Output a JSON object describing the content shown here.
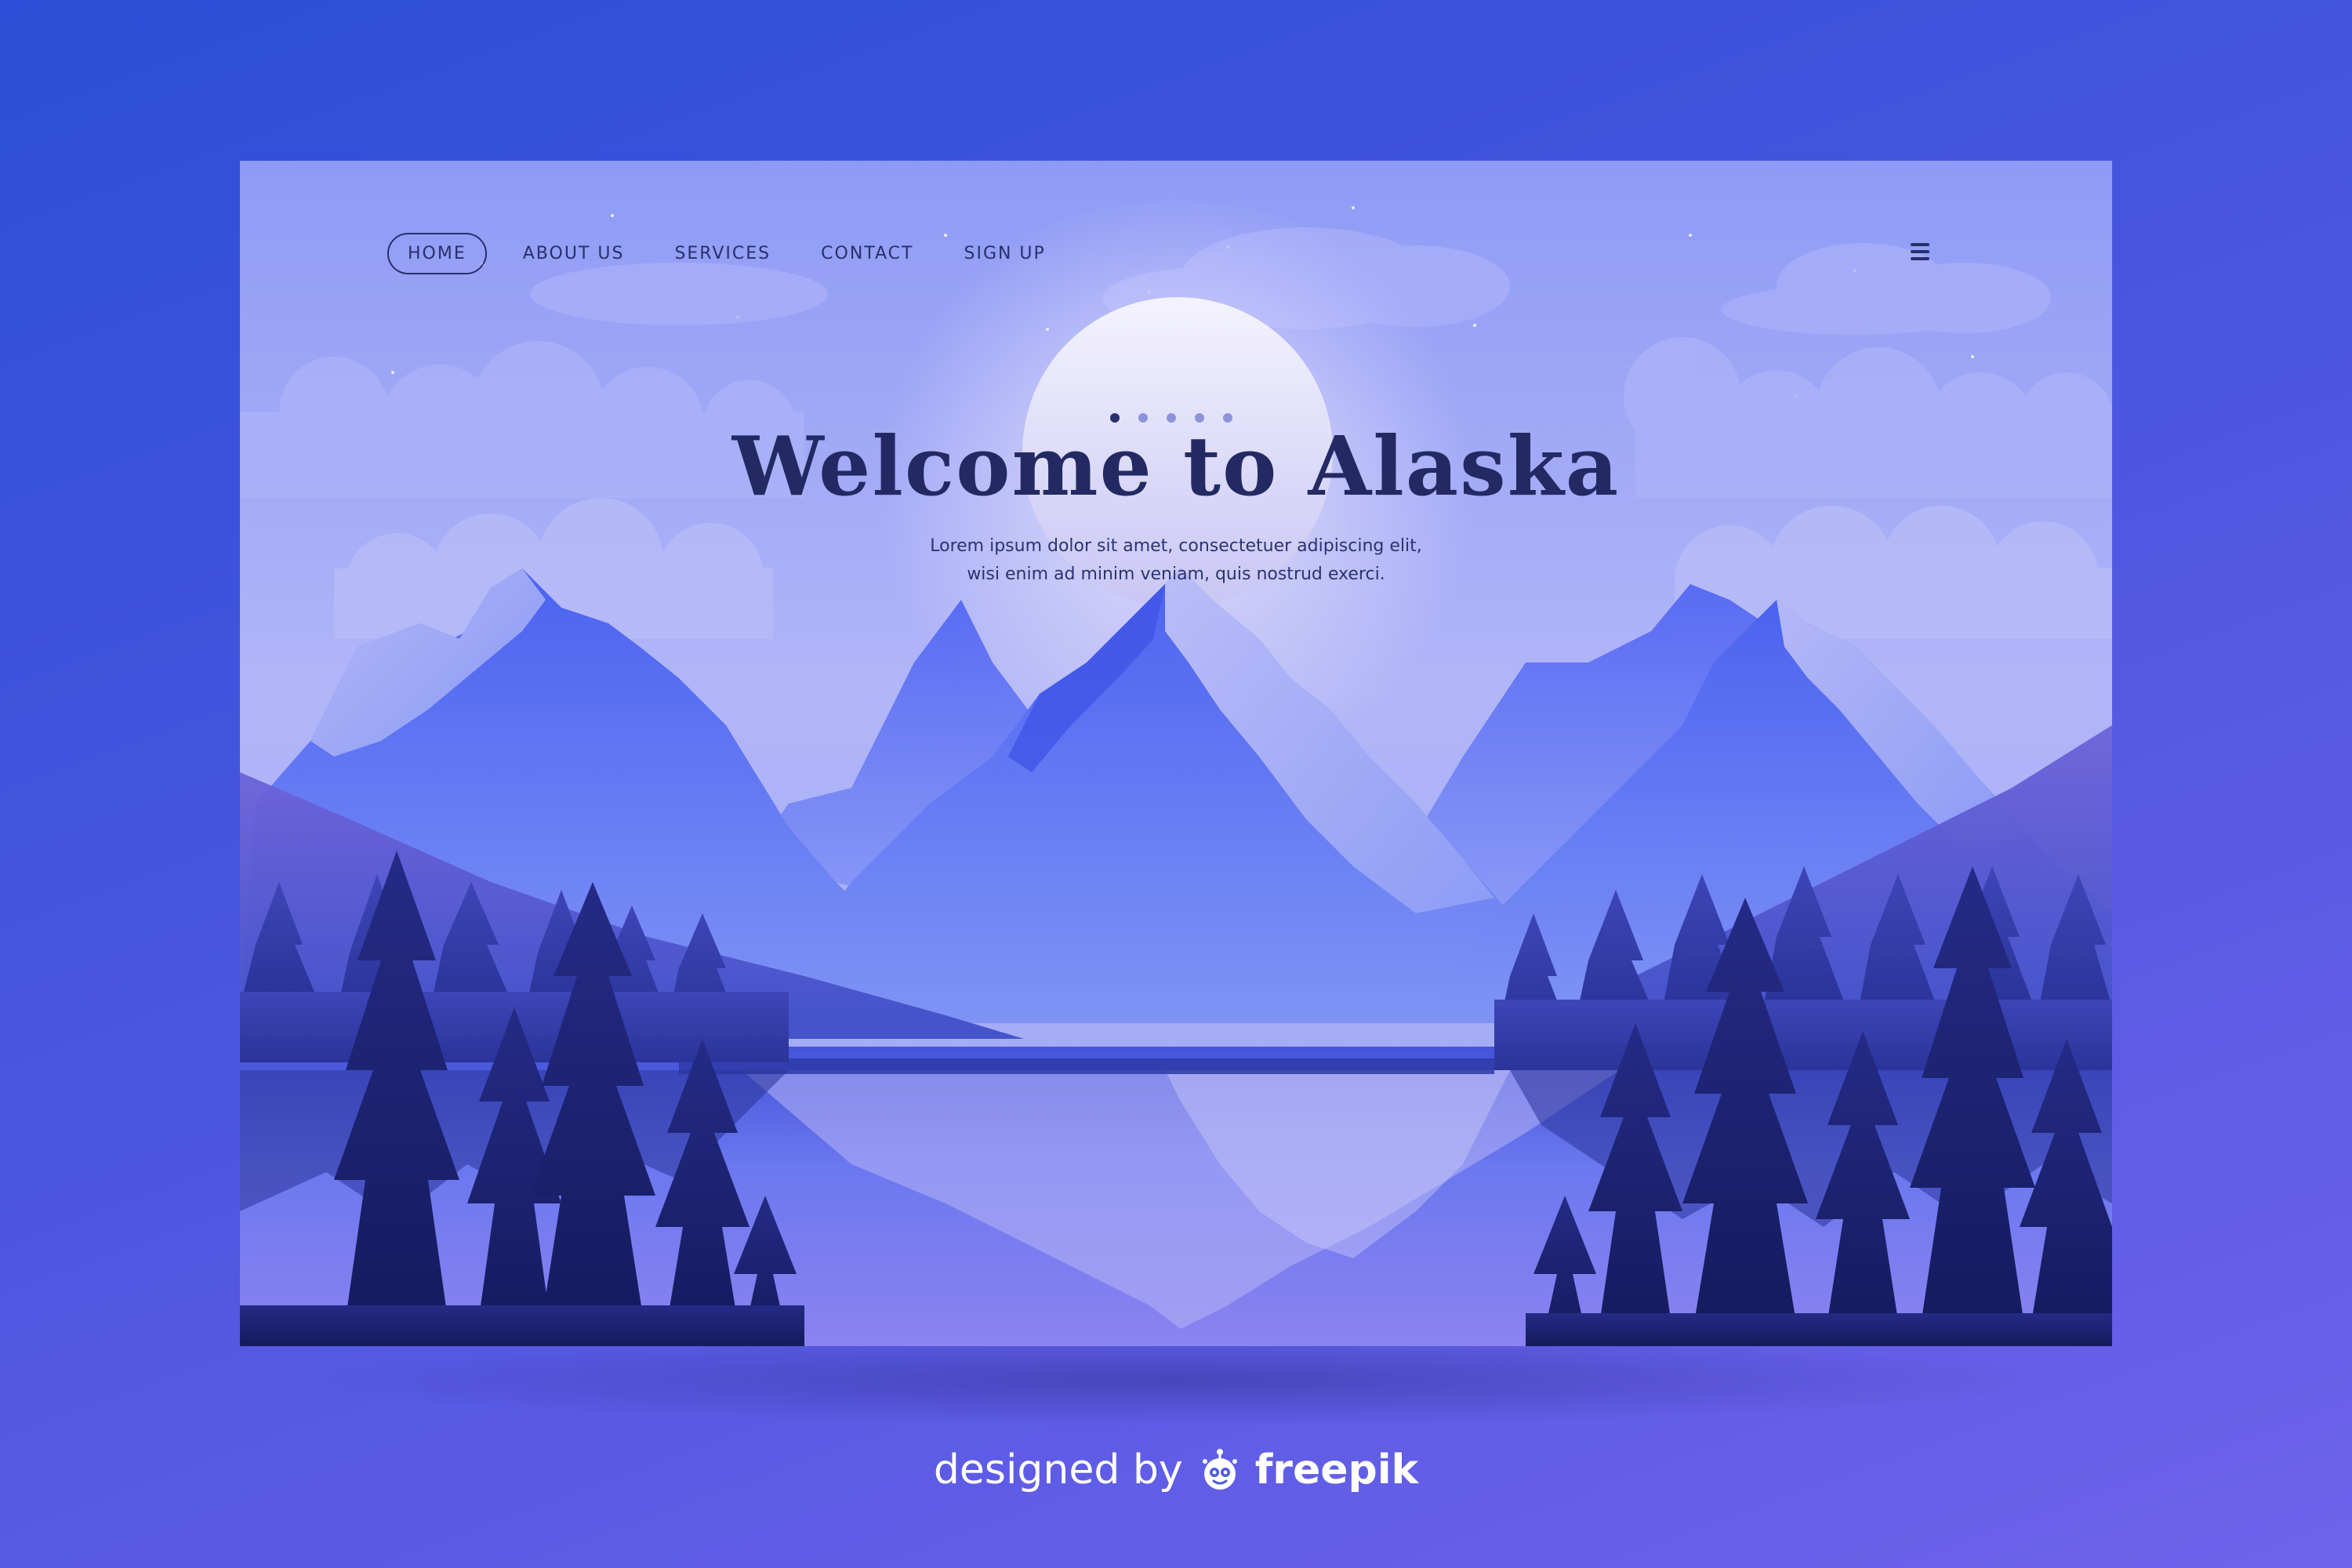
{
  "nav": {
    "items": [
      {
        "label": "HOME",
        "active": true
      },
      {
        "label": "ABOUT US",
        "active": false
      },
      {
        "label": "SERVICES",
        "active": false
      },
      {
        "label": "CONTACT",
        "active": false
      },
      {
        "label": "SIGN UP",
        "active": false
      }
    ],
    "menu_icon": "hamburger-menu-icon"
  },
  "slider": {
    "count": 5,
    "active_index": 0
  },
  "hero": {
    "title": "Welcome to Alaska",
    "subtitle_line1": "Lorem ipsum dolor sit amet, consectetuer adipiscing elit,",
    "subtitle_line2": "wisi enim ad minim veniam, quis nostrud exerci."
  },
  "credit": {
    "prefix": "designed by",
    "brand": "freepik",
    "logo_icon": "freepik-logo-icon"
  },
  "colors": {
    "background_start": "#2b4fd8",
    "background_end": "#6e62ea",
    "text_dark": "#27306b",
    "moon": "#e6e6fb",
    "mountain": "#5b6cf0",
    "trees": "#1d2370"
  }
}
